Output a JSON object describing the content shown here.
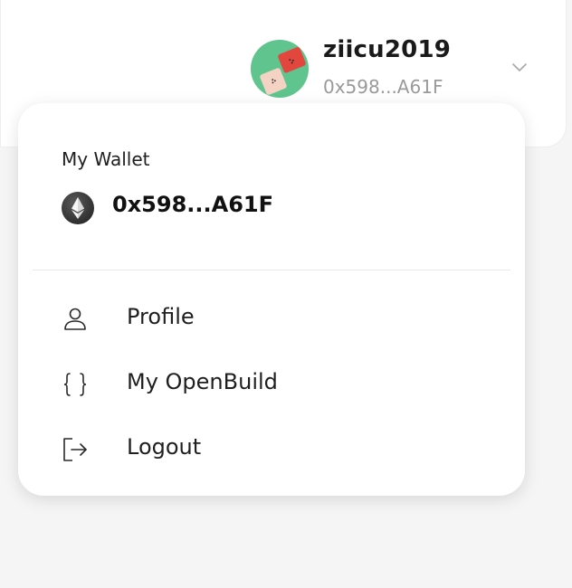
{
  "header": {
    "username": "ziicu2019",
    "address_short": "0x598...A61F",
    "avatar_icon": "avatar-icon",
    "chevron_icon": "chevron-down-icon"
  },
  "dropdown": {
    "wallet_title": "My Wallet",
    "wallet_address": "0x598...A61F",
    "network_icon": "ethereum-icon",
    "items": [
      {
        "label": "Profile",
        "icon": "user-icon"
      },
      {
        "label": "My OpenBuild",
        "icon": "braces-icon"
      },
      {
        "label": "Logout",
        "icon": "logout-icon"
      }
    ]
  },
  "colors": {
    "page_bg": "#f5f5f5",
    "card_bg": "#ffffff",
    "muted_text": "#9a9a9a",
    "avatar_green": "#5fc48d",
    "avatar_red": "#e2463d",
    "avatar_skin": "#f4d2c4",
    "eth_dark": "#3a3a3a"
  }
}
